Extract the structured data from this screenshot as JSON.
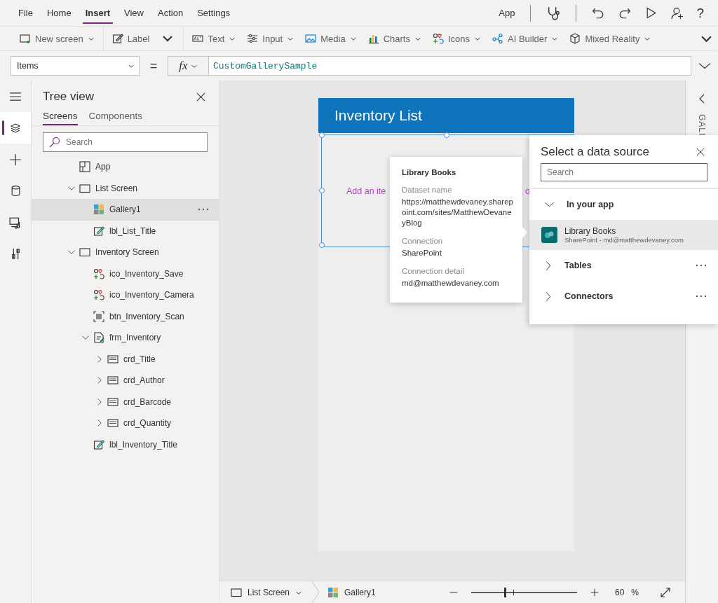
{
  "menu": [
    {
      "label": "File",
      "selected": false
    },
    {
      "label": "Home",
      "selected": false
    },
    {
      "label": "Insert",
      "selected": true
    },
    {
      "label": "View",
      "selected": false
    },
    {
      "label": "Action",
      "selected": false
    },
    {
      "label": "Settings",
      "selected": false
    }
  ],
  "app_button": "App",
  "help": "?",
  "toolbar": [
    {
      "kind": "newscreen",
      "label": "New screen",
      "dropdown": true
    },
    {
      "kind": "label",
      "label": "Label",
      "dropdown": false
    },
    {
      "kind": "text",
      "label": "Text",
      "dropdown": true
    },
    {
      "kind": "input",
      "label": "Input",
      "dropdown": true
    },
    {
      "kind": "media",
      "label": "Media",
      "dropdown": true
    },
    {
      "kind": "charts",
      "label": "Charts",
      "dropdown": true
    },
    {
      "kind": "icons",
      "label": "Icons",
      "dropdown": true
    },
    {
      "kind": "aibuilder",
      "label": "AI Builder",
      "dropdown": true
    },
    {
      "kind": "mixedreality",
      "label": "Mixed Reality",
      "dropdown": true
    }
  ],
  "formula_bar": {
    "property": "Items",
    "equals": "=",
    "fx": "fx",
    "formula": "CustomGallerySample"
  },
  "rail": [
    {
      "kind": "menu",
      "selected": false
    },
    {
      "kind": "layers",
      "selected": true
    },
    {
      "kind": "insert",
      "selected": false
    },
    {
      "kind": "data",
      "selected": false
    },
    {
      "kind": "media",
      "selected": false
    },
    {
      "kind": "tools",
      "selected": false
    }
  ],
  "tree_view": {
    "title": "Tree view",
    "tabs": [
      {
        "label": "Screens",
        "selected": true
      },
      {
        "label": "Components",
        "selected": false
      }
    ],
    "search": {
      "placeholder": "Search"
    },
    "items": [
      {
        "label": "App",
        "kind": "app",
        "selected": false
      },
      {
        "label": "List Screen",
        "kind": "screen",
        "selected": false,
        "expanded": true,
        "children": [
          {
            "label": "Gallery1",
            "kind": "gallery",
            "selected": true
          },
          {
            "label": "lbl_List_Title",
            "kind": "label",
            "selected": false
          }
        ]
      },
      {
        "label": "Inventory Screen",
        "kind": "screen",
        "selected": false,
        "expanded": true,
        "children": [
          {
            "label": "ico_Inventory_Save",
            "kind": "icon",
            "selected": false
          },
          {
            "label": "ico_Inventory_Camera",
            "kind": "icon",
            "selected": false
          },
          {
            "label": "btn_Inventory_Scan",
            "kind": "button",
            "selected": false
          },
          {
            "label": "frm_Inventory",
            "kind": "form",
            "selected": false,
            "expanded": true,
            "children": [
              {
                "label": "crd_Title",
                "kind": "card",
                "selected": false,
                "expanded": false
              },
              {
                "label": "crd_Author",
                "kind": "card",
                "selected": false,
                "expanded": false
              },
              {
                "label": "crd_Barcode",
                "kind": "card",
                "selected": false,
                "expanded": false
              },
              {
                "label": "crd_Quantity",
                "kind": "card",
                "selected": false,
                "expanded": false
              }
            ]
          },
          {
            "label": "lbl_Inventory_Title",
            "kind": "label",
            "selected": false
          }
        ]
      }
    ]
  },
  "app_screen": {
    "header": "Inventory List",
    "gallery_hint_left": "Add an ite",
    "gallery_hint_right": "o"
  },
  "tooltip": {
    "title": "Library Books",
    "fields": [
      {
        "label": "Dataset name",
        "value": "https://matthewdevaney.sharepoint.com/sites/MatthewDevaneyBlog"
      },
      {
        "label": "Connection",
        "value": "SharePoint"
      },
      {
        "label": "Connection detail",
        "value": "md@matthewdevaney.com"
      }
    ]
  },
  "data_source_panel": {
    "title": "Select a data source",
    "search": {
      "placeholder": "Search"
    },
    "groups": [
      {
        "label": "In your app",
        "expanded": true,
        "items": [
          {
            "name": "Library Books",
            "detail": "SharePoint - md@matthewdevaney.com",
            "selected": true
          }
        ]
      },
      {
        "label": "Tables",
        "expanded": false
      },
      {
        "label": "Connectors",
        "expanded": false
      }
    ]
  },
  "right_panel": {
    "vertical_label": "GALI"
  },
  "status_bar": {
    "screen": "List Screen",
    "control": "Gallery1",
    "zoom": {
      "level": 0.32
    },
    "zoom_value": "60",
    "zoom_unit": "%"
  }
}
